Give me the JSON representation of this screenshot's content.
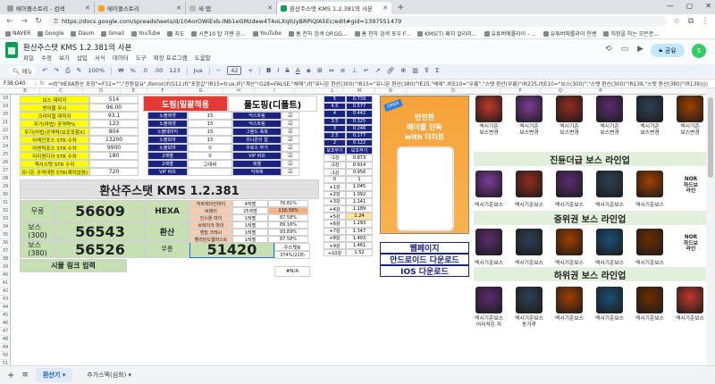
{
  "browser": {
    "tabs": [
      {
        "label": "메이플스토리 - 검색",
        "active": false
      },
      {
        "label": "메이플스토리",
        "active": false
      },
      {
        "label": "새 탭",
        "active": false
      },
      {
        "label": "환산주스탯 KMS 1.2.381의 사본",
        "active": true
      }
    ],
    "url": "https://docs.google.com/spreadsheets/d/10AorOWiExb-lNb1eGMzdew4T4oLXqtUyBRPiQlA5Ec/edit#gid=1397551479",
    "bookmarks": [
      "NAVER",
      "Google",
      "Daum",
      "Gmail",
      "YouTube",
      "지도",
      "시즌10 탑 가젠 공...",
      "YouTube",
      "홈 천하 검색 OP.GG...",
      "홈 천하 검색 포우 F...",
      "KMS(T) 패치 알리미...",
      "유튜버에롤라이 - ...",
      "유튜버에롤라이 인벤",
      "직장을 하는 모든분..."
    ]
  },
  "doc": {
    "title": "환산주스탯 KMS 1.2.381의 사본",
    "menus": [
      "파일",
      "수정",
      "보기",
      "삽입",
      "서식",
      "데이터",
      "도구",
      "확장 프로그램",
      "도움말"
    ],
    "share_label": "공유",
    "avatar": "S"
  },
  "toolbar": {
    "search": "메뉴",
    "zoom": "100%",
    "currency": "₩",
    "percent": "%",
    "dec1": ".0",
    "dec2": ".00",
    "num": "123",
    "font": "Jua",
    "font_size": "42"
  },
  "formula_bar": {
    "cellref": "F38:G40",
    "formula": "=if(\"HEXA환산 포함\"=F32=\"\",\"전환필요\",iferror(if(G12,if(\"포함값\"!R15=true,IF(\"계산\"!G28=FALSE,\"해제\",if(\"유니온 환산(300)\"!R15=\"유니온 환산(380)\"!E15,\"해제\",if(E10=\"무릉\",\"스탯 환산(무릉)\"!R235,if(E10=\"보스(300)\",\"스탯 환산(300)\"!R139,\"스탯 환산(380)\"!R139))))"
  },
  "columns": [
    "B",
    "C",
    "D",
    "E",
    "F",
    "G",
    "H",
    "I",
    "L",
    "M",
    "N",
    "O",
    "P",
    "Q",
    "R"
  ],
  "rows": [
    "18",
    "19",
    "20",
    "21",
    "22",
    "23",
    "24",
    "25",
    "26",
    "27",
    "28",
    "29",
    "30",
    "31",
    "32",
    "33",
    "34",
    "35",
    "36",
    "37",
    "38",
    "39",
    "40",
    "41",
    "42",
    "43",
    "44",
    "45",
    "46",
    "47",
    "48",
    "49",
    "50",
    "51"
  ],
  "stats": {
    "labels": [
      "보스 데미지",
      "방어율 무시",
      "크리티컬 데미지",
      "무기(마법) 공격력%",
      "무기(마법)공격력(보조포함X)",
      "아케인포스 STR 수치",
      "어센틱포스 STR 수치",
      "미리원디아 STR 수치",
      "헥사스텟 STR 수치",
      "유니온 공격대원 STR(제외없음)"
    ],
    "values": [
      "514",
      "96.00",
      "93.1",
      "123",
      "804",
      "13200",
      "9900",
      "180",
      "",
      "720"
    ]
  },
  "sections": {
    "left_title": "도핑|일괄적용",
    "right_title": "풀도핑(디폴트)",
    "main_title": "환산주스탯 KMS 1.2.381"
  },
  "doping": [
    {
      "name": "노블레셋",
      "val": "15",
      "opt": "익스트림"
    },
    {
      "name": "노블레셋",
      "val": "15",
      "opt": "익스트림"
    },
    {
      "name": "노블데미지",
      "val": "15",
      "opt": "그랜드 축복"
    },
    {
      "name": "노블보마",
      "val": "15",
      "opt": "유니온의 힘"
    },
    {
      "name": "노블보마",
      "val": "0",
      "opt": "우로스 부기"
    },
    {
      "name": "2레벨",
      "val": "0",
      "opt": "VIP 버프"
    },
    {
      "name": "2레벨",
      "val": "고대비",
      "opt": "레벨"
    },
    {
      "name": "VIP 버프",
      "val": "",
      "opt": "익혀재"
    }
  ],
  "results": [
    {
      "label": "무릉",
      "value": "56609"
    },
    {
      "label": "보스\n(300)",
      "value": "56543"
    },
    {
      "label": "보스\n(380)",
      "value": "56526"
    }
  ],
  "hexa": {
    "label1": "HEXA",
    "label2": "환산",
    "label3": "무릉",
    "value": "51420"
  },
  "hexa_table": [
    {
      "name": "히트레이인마지",
      "lv": "4레벨",
      "pct": "76.81%"
    },
    {
      "name": "브레이",
      "lv": "25레벨",
      "pct": "118.38%"
    },
    {
      "name": "인스톨 마이",
      "lv": "1레벨",
      "pct": "87.58%"
    },
    {
      "name": "브레이크 마이",
      "lv": "1레벨",
      "pct": "89.16%"
    },
    {
      "name": "엔빌 크레시",
      "lv": "1레벨",
      "pct": "93.89%"
    },
    {
      "name": "헬리던드웹마스트",
      "lv": "1레벨",
      "pct": "87.58%"
    }
  ],
  "score_label": "주스탯R",
  "score_value": "374%(228)",
  "link_label": "시뮬 링크 입력",
  "na_value": "#N/A",
  "weapon_table": [
    [
      "5",
      "0.739"
    ],
    [
      "4.5",
      "0.577"
    ],
    [
      "4",
      "0.442"
    ],
    [
      "3.5",
      "0.325"
    ],
    [
      "3",
      "0.246"
    ],
    [
      "2.5",
      "0.177"
    ],
    [
      "2",
      "0.122"
    ],
    [
      "보조무기",
      "보조무기"
    ],
    [
      "-1강",
      "0.873"
    ],
    [
      "-2강",
      "0.914"
    ],
    [
      "-1강",
      "0.956"
    ],
    [
      "0",
      "1"
    ],
    [
      "+1강",
      "1.045"
    ],
    [
      "+2강",
      "1.092"
    ],
    [
      "+3강",
      "1.141"
    ],
    [
      "+4강",
      "1.189"
    ],
    [
      "+5강",
      "1.24"
    ],
    [
      "+6강",
      "1.293"
    ],
    [
      "+7강",
      "1.347"
    ],
    [
      "+8강",
      "1.403"
    ],
    [
      "+9강",
      "1.461"
    ],
    [
      "+10강",
      "1.52"
    ]
  ],
  "ad": {
    "badge": "OPEN",
    "line1": "안전한",
    "line2": "메이플 단독",
    "line3": "with 더치트",
    "links": [
      "웹페이지",
      "안드로이드 다운로드",
      "IOS 다운로드"
    ]
  },
  "boss_sections": [
    "진듄더급 보스 라인업",
    "중위권 보스 라인업",
    "하위권 보스 라인업"
  ],
  "boss_top": [
    "엑시기준\n보스변경",
    "엑시기준\n보스변경",
    "엑시기준\n보스변경",
    "엑시기준\n보스변경",
    "엑시기준\n보스변경",
    "엑시기준\n보스변경"
  ],
  "boss_row_label": "엑시기준보스",
  "boss_bottom": [
    "엑시기준보스\n어리석은 자",
    "엑시기준보스\n동가루",
    "엑시기준보스",
    "엑시기준보스",
    "엑시기준보스",
    "엑시기준보스"
  ],
  "nor_label": "NOR\n하드보\n라인",
  "sheet_tabs": [
    "환산기",
    "추가스펙(심화)"
  ],
  "colors": {
    "accent_red": "#e53935",
    "accent_navy": "#1a237e",
    "yellow": "#ffff00",
    "green_fill": "#c6e0b4"
  }
}
